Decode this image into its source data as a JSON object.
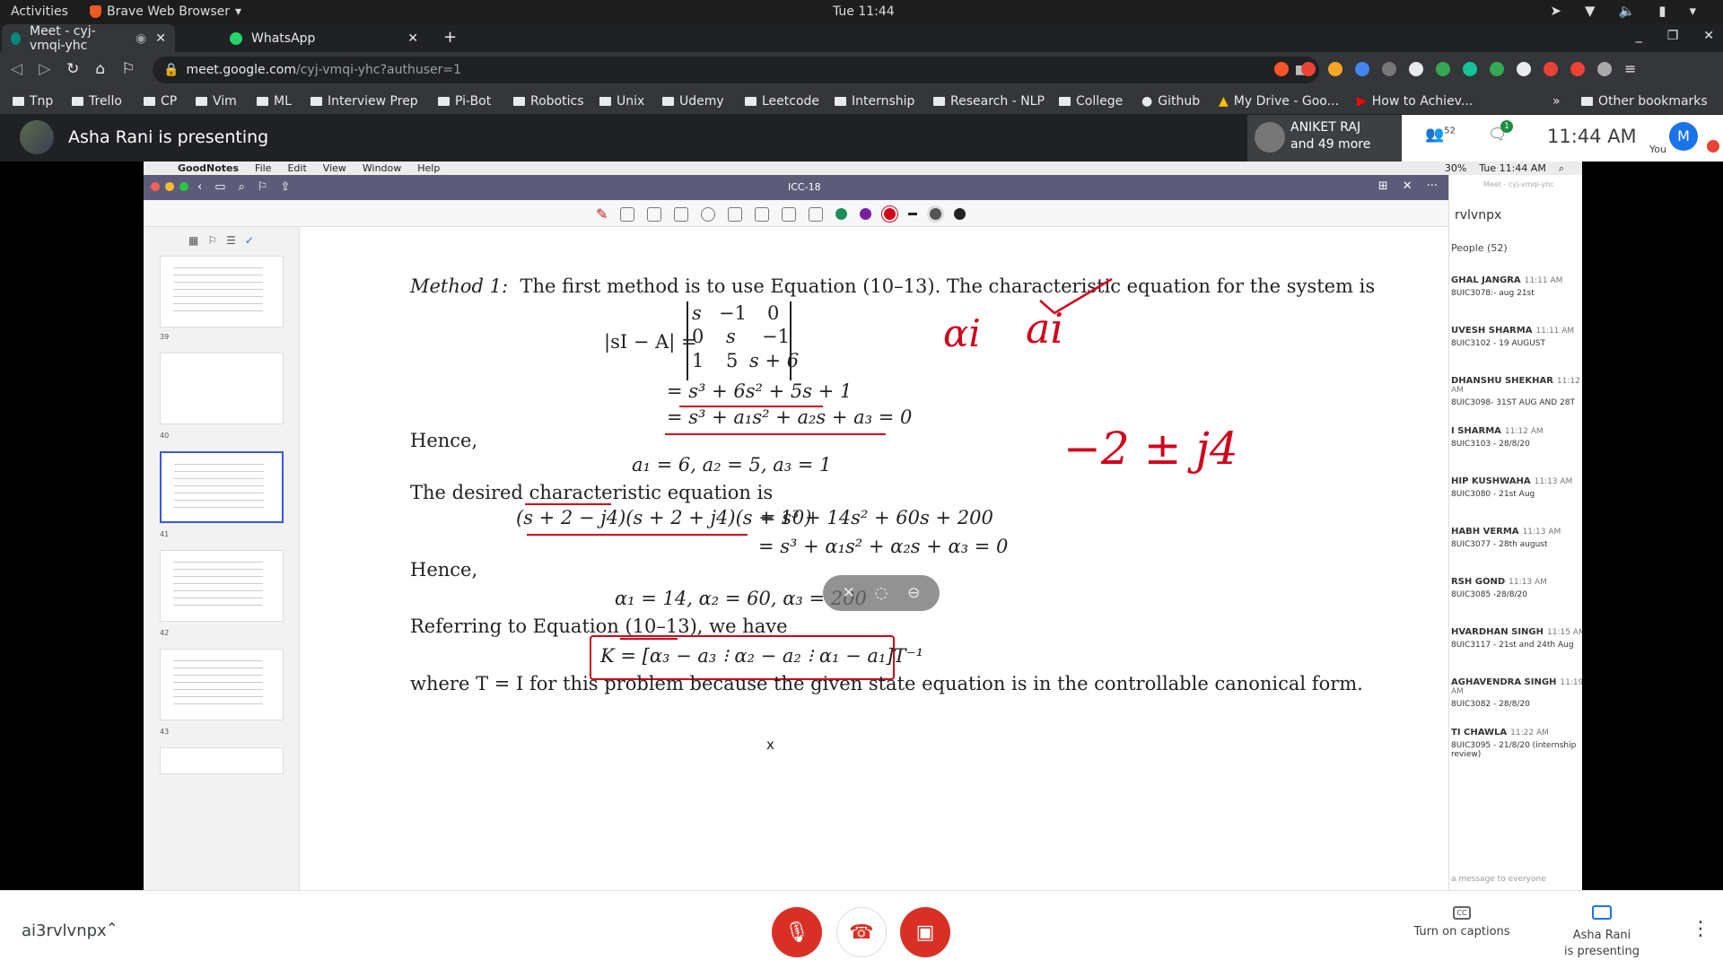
{
  "gnome": {
    "activities": "Activities",
    "app_menu": "Brave Web Browser",
    "clock": "Tue 11:44"
  },
  "tabs": [
    {
      "label": "Meet - cyj-vmqi-yhc",
      "color": "#00897b"
    },
    {
      "label": "WhatsApp",
      "color": "#25d366"
    }
  ],
  "omnibox": {
    "host": "meet.google.com",
    "path": "/cyj-vmqi-yhc?authuser=1"
  },
  "bookmarks": [
    "Tnp",
    "Trello",
    "CP",
    "Vim",
    "ML",
    "Interview Prep",
    "Pi-Bot",
    "Robotics",
    "Unix",
    "Udemy",
    "Leetcode",
    "Internship",
    "Research - NLP",
    "College",
    "Github",
    "My Drive - Goo...",
    "How to Achiev...",
    "Other bookmarks"
  ],
  "meet_header": {
    "presenting": "Asha Rani is presenting",
    "pinned_name": "ANIKET RAJ",
    "pinned_more": "and 49 more",
    "people_count": "52",
    "chat_badge": "1",
    "time": "11:44 AM",
    "self_initial": "M",
    "self_label": "You"
  },
  "mac": {
    "menu": [
      "GoodNotes",
      "File",
      "Edit",
      "View",
      "Window",
      "Help"
    ],
    "battery": "30%",
    "clock": "Tue 11:44 AM"
  },
  "goodnotes": {
    "doc_title": "ICC-18",
    "thumbs": [
      {
        "num": "39"
      },
      {
        "num": "40"
      },
      {
        "num": "41"
      },
      {
        "num": "42"
      },
      {
        "num": "43"
      }
    ],
    "colors": {
      "green": "#1a8f5a",
      "purple": "#7b1fa2",
      "red": "#d0011b",
      "black": "#222222"
    }
  },
  "page": {
    "method_label": "Method 1:",
    "method_text": "The first method is to use Equation (10–13). The characteristic equation for the system is",
    "det_lhs": "|sI − A| =",
    "det_rows": [
      [
        "s",
        "−1",
        "0"
      ],
      [
        "0",
        "s",
        "−1"
      ],
      [
        "1",
        "5",
        "s + 6"
      ]
    ],
    "eq1": "= s³ + 6s² + 5s + 1",
    "eq2": "= s³ + a₁s² + a₂s + a₃ = 0",
    "hence1": "Hence,",
    "a_vals": "a₁ = 6,      a₂ = 5,      a₃ = 1",
    "desired": "The desired characteristic equation is",
    "desired_eq_left": "(s + 2 − j4)(s + 2 + j4)(s + 10)",
    "desired_eq_right": "= s³ + 14s² + 60s + 200",
    "desired_eq2": "= s³ + α₁s² + α₂s + α₃ = 0",
    "hence2": "Hence,",
    "alpha_vals": "α₁ = 14,      α₂ = 60,      α₃ = 200",
    "referring": "Referring to Equation (10–13), we have",
    "k_eq": "K = [α₃ − a₃ ⁝ α₂ − a₂ ⁝ α₁ − a₁]T⁻¹",
    "where": "where T = I for this problem because the given state equation is in the controllable canonical form.",
    "close_x": "x",
    "ink_alpha_i": "αi",
    "ink_a_i": "ai",
    "ink_poles": "−2 ± j4"
  },
  "chat_panel": {
    "url": "Meet - cyj-vmqi-yhc",
    "title": "rvlvnpx",
    "people": "People (52)",
    "messages": [
      {
        "who": "GHAL JANGRA",
        "when": "11:11 AM",
        "text": "8UIC3078:- aug 21st"
      },
      {
        "who": "UVESH SHARMA",
        "when": "11:11 AM",
        "text": "8UIC3102 - 19 AUGUST"
      },
      {
        "who": "DHANSHU SHEKHAR",
        "when": "11:12 AM",
        "text": "8UIC3098- 31ST AUG AND 28T"
      },
      {
        "who": "I SHARMA",
        "when": "11:12 AM",
        "text": "8UIC3103 - 28/8/20"
      },
      {
        "who": "HIP KUSHWAHA",
        "when": "11:13 AM",
        "text": "8UIC3080 - 21st Aug"
      },
      {
        "who": "HABH VERMA",
        "when": "11:13 AM",
        "text": "8UIC3077 - 28th august"
      },
      {
        "who": "RSH GOND",
        "when": "11:13 AM",
        "text": "8UIC3085 -28/8/20"
      },
      {
        "who": "HVARDHAN SINGH",
        "when": "11:15 AM",
        "text": "8UIC3117 - 21st and 24th Aug"
      },
      {
        "who": "AGHAVENDRA SINGH",
        "when": "11:19 AM",
        "text": "8UIC3082 - 28/8/20"
      },
      {
        "who": "TI CHAWLA",
        "when": "11:22 AM",
        "text": "8UIC3095 - 21/8/20 (internship review)"
      }
    ],
    "input_placeholder": "a message to everyone"
  },
  "meet_bottom": {
    "code": "ai3rvlvnpx",
    "captions": "Turn on captions",
    "presenter_line1": "Asha Rani",
    "presenter_line2": "is presenting"
  }
}
